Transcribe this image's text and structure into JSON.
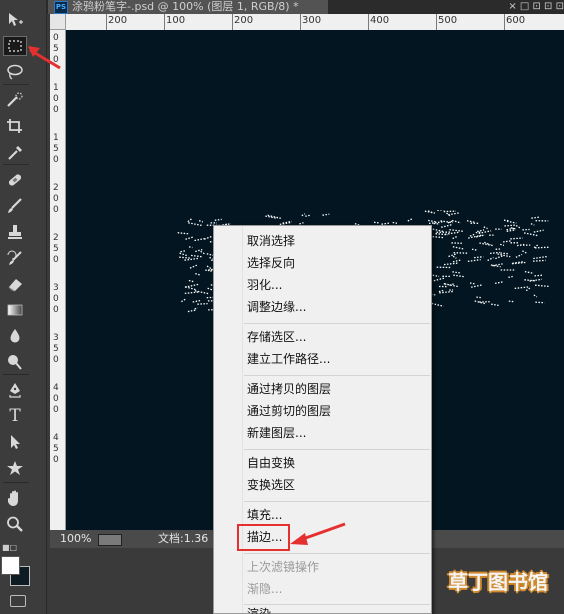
{
  "tab": {
    "title": "涂鸦粉笔字-.psd @ 100% (图层 1, RGB/8) *",
    "app_icon": "PS",
    "window_controls": "× □ ⊡ ⊡ ⊡"
  },
  "ruler_top": {
    "labels": [
      "200",
      "100",
      "200",
      "300",
      "400",
      "500",
      "600"
    ]
  },
  "ruler_left": {
    "labels": [
      "0",
      "5",
      "0",
      "1",
      "0",
      "0",
      "1",
      "5",
      "0",
      "2",
      "0",
      "0",
      "2",
      "5",
      "0",
      "3",
      "0",
      "0",
      "3",
      "5",
      "0",
      "4",
      "0",
      "0",
      "4",
      "5",
      "0"
    ]
  },
  "status": {
    "zoom": "100%",
    "doc_info": "文档:1.36"
  },
  "context_menu": {
    "items": [
      {
        "label": "取消选择",
        "enabled": true
      },
      {
        "label": "选择反向",
        "enabled": true
      },
      {
        "label": "羽化...",
        "enabled": true
      },
      {
        "label": "调整边缘...",
        "enabled": true
      },
      {
        "label": "存储选区...",
        "enabled": true
      },
      {
        "label": "建立工作路径...",
        "enabled": true
      },
      {
        "label": "通过拷贝的图层",
        "enabled": true
      },
      {
        "label": "通过剪切的图层",
        "enabled": true
      },
      {
        "label": "新建图层...",
        "enabled": true
      },
      {
        "label": "自由变换",
        "enabled": true
      },
      {
        "label": "变换选区",
        "enabled": true
      },
      {
        "label": "填充...",
        "enabled": true
      },
      {
        "label": "描边...",
        "enabled": true
      },
      {
        "label": "上次滤镜操作",
        "enabled": false
      },
      {
        "label": "渐隐...",
        "enabled": false
      },
      {
        "label": "渲染",
        "enabled": true
      }
    ]
  },
  "tools": [
    "move-tool-icon",
    "marquee-tool-icon",
    "lasso-tool-icon",
    "quick-selection-tool-icon",
    "crop-tool-icon",
    "eyedropper-tool-icon",
    "healing-brush-tool-icon",
    "brush-tool-icon",
    "clone-stamp-tool-icon",
    "history-brush-tool-icon",
    "eraser-tool-icon",
    "gradient-tool-icon",
    "blur-tool-icon",
    "dodge-tool-icon",
    "pen-tool-icon",
    "type-tool-icon",
    "path-selection-tool-icon",
    "shape-tool-icon",
    "hand-tool-icon",
    "zoom-tool-icon"
  ],
  "colors": {
    "canvas_bg": "#021520",
    "annotation_red": "#e53030",
    "foreground": "#ffffff",
    "background": "#0d1b22"
  },
  "watermark": {
    "text": "草丁图书馆"
  }
}
